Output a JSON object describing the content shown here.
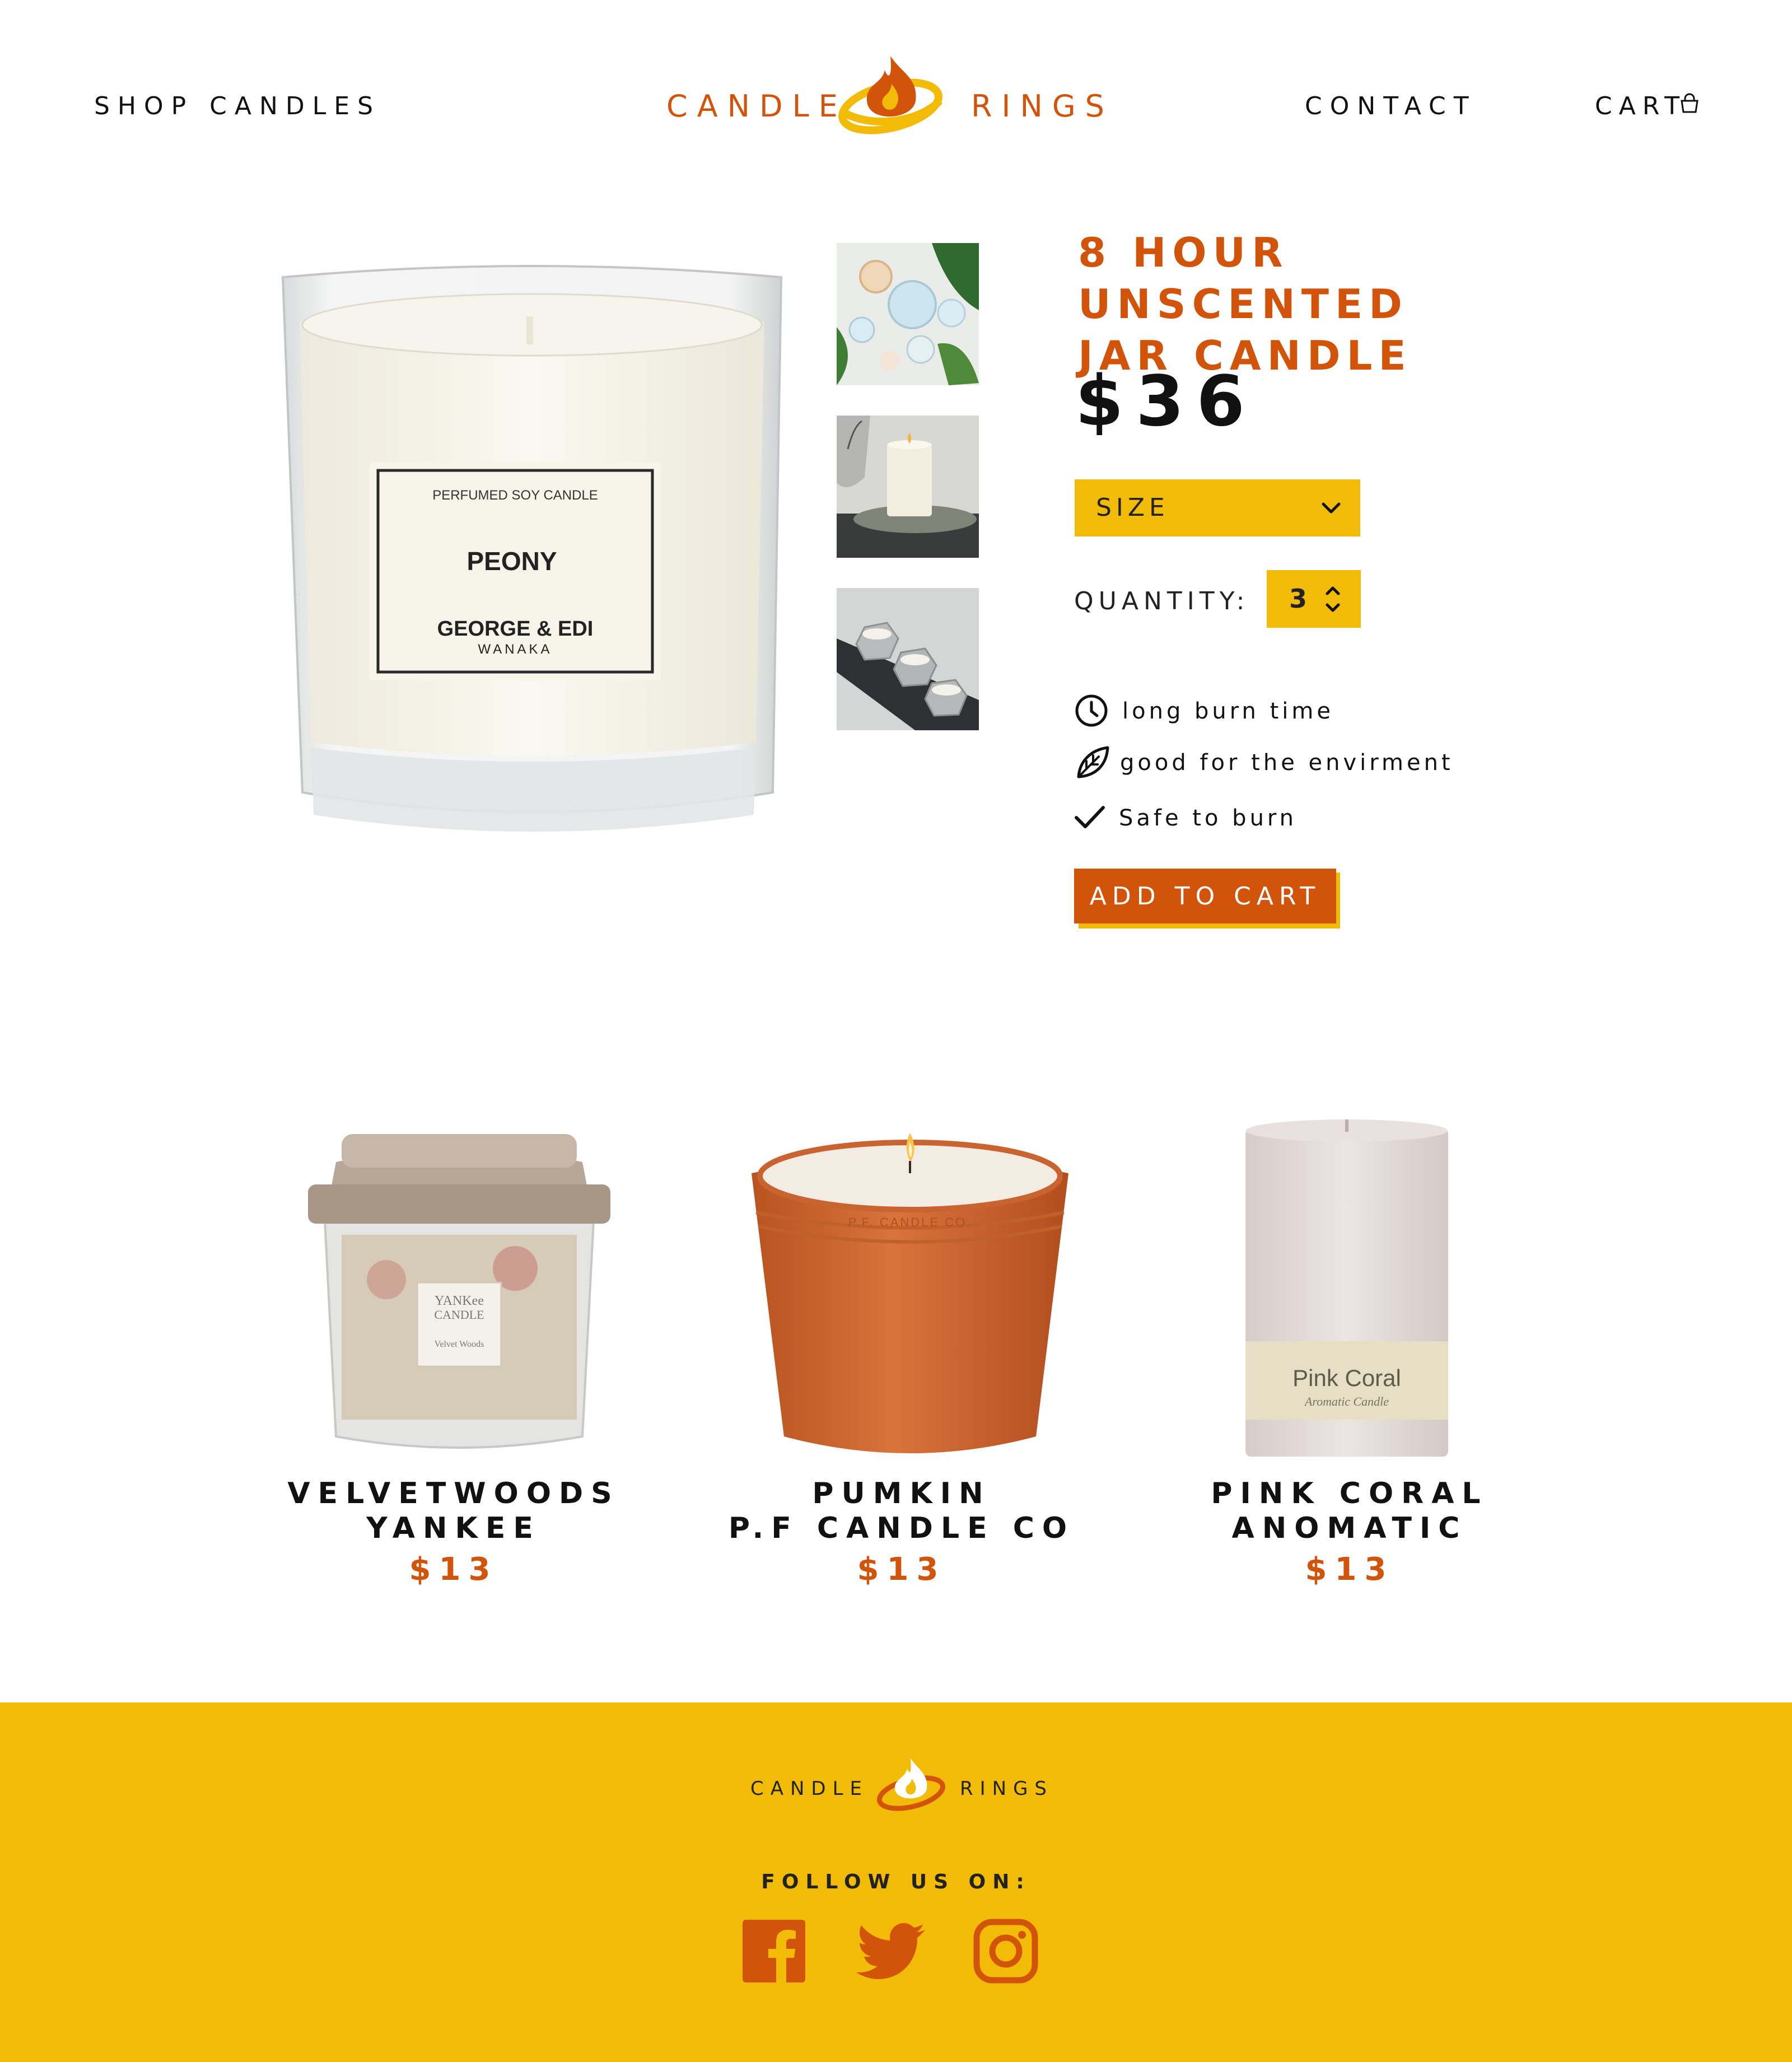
{
  "nav": {
    "shop": "SHOP CANDLES",
    "contact": "CONTACT",
    "cart": "CART"
  },
  "logo": {
    "left": "CANDLE",
    "right": "RINGS"
  },
  "product": {
    "title_line1": "8 HOUR UNSCENTED",
    "title_line2": "JAR CANDLE",
    "price": "$36",
    "size_label": "SIZE",
    "quantity_label": "QUANTITY:",
    "quantity_value": "3",
    "label": {
      "top": "PERFUMED SOY CANDLE",
      "name": "PEONY",
      "brand": "GEORGE & EDI",
      "place": "WANAKA"
    },
    "features": [
      {
        "icon": "clock-icon",
        "text": "long burn time"
      },
      {
        "icon": "leaf-icon",
        "text": "good for the envirment"
      },
      {
        "icon": "check-icon",
        "text": "Safe to burn"
      }
    ],
    "add_to_cart": "ADD TO CART"
  },
  "related": [
    {
      "line1": "VELVETWOODS",
      "line2": "YANKEE",
      "price": "$13",
      "jar_text1": "YANKee",
      "jar_text2": "CANDLE",
      "jar_text3": "Velvet Woods"
    },
    {
      "line1": "PUMKIN",
      "line2": "P.F CANDLE CO",
      "price": "$13",
      "jar_text1": "P.F. CANDLE CO."
    },
    {
      "line1": "PINK CORAL",
      "line2": "ANOMATIC",
      "price": "$13",
      "jar_text1": "Pink Coral",
      "jar_text2": "Aromatic Candle"
    }
  ],
  "footer": {
    "logo_left": "CANDLE",
    "logo_right": "RINGS",
    "follow": "FOLLOW US ON:",
    "social": [
      "facebook-icon",
      "twitter-icon",
      "instagram-icon"
    ]
  },
  "colors": {
    "accent_orange": "#d2540b",
    "accent_yellow": "#f2bb07",
    "text_dark": "#111111"
  }
}
